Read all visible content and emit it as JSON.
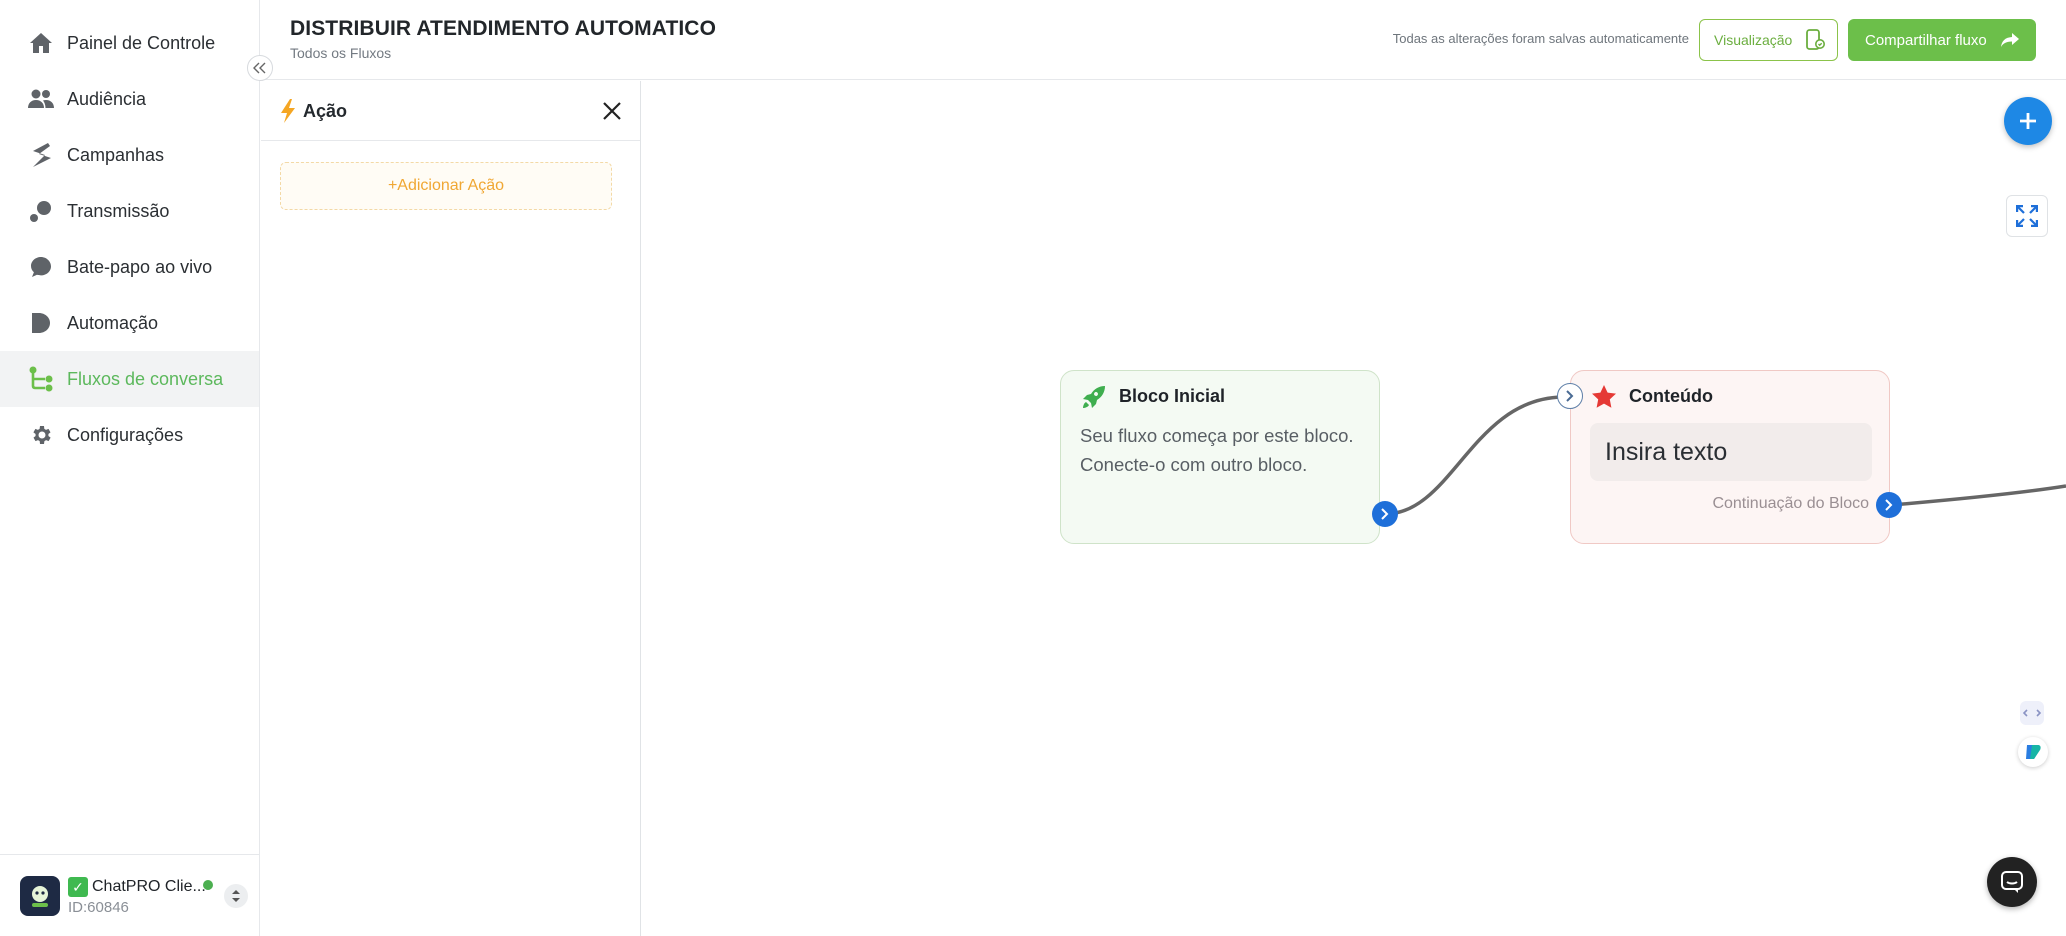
{
  "sidebar": {
    "items": [
      {
        "label": "Painel de Controle",
        "icon": "home-icon"
      },
      {
        "label": "Audiência",
        "icon": "users-icon"
      },
      {
        "label": "Campanhas",
        "icon": "campaign-icon"
      },
      {
        "label": "Transmissão",
        "icon": "broadcast-icon"
      },
      {
        "label": "Bate-papo ao vivo",
        "icon": "chat-icon"
      },
      {
        "label": "Automação",
        "icon": "automation-icon"
      },
      {
        "label": "Fluxos de conversa",
        "icon": "flow-icon"
      },
      {
        "label": "Configurações",
        "icon": "gear-icon"
      }
    ],
    "active_index": 6,
    "account": {
      "name": "ChatPRO Clie...",
      "id": "ID:60846",
      "status_color": "#4caf50"
    }
  },
  "header": {
    "title": "DISTRIBUIR ATENDIMENTO AUTOMATICO",
    "breadcrumb": "Todos os Fluxos",
    "saved_status": "Todas as alterações foram salvas automaticamente",
    "preview_label": "Visualização",
    "share_label": "Compartilhar fluxo"
  },
  "panel": {
    "title": "Ação",
    "add_action_label": "+Adicionar Ação"
  },
  "canvas": {
    "start_block": {
      "title": "Bloco Inicial",
      "description": "Seu fluxo começa por este bloco. Conecte-o com outro bloco."
    },
    "content_block": {
      "title": "Conteúdo",
      "input_text": "Insira texto",
      "continuation_label": "Continuação do Bloco"
    }
  },
  "colors": {
    "accent_green": "#6cbf4a",
    "active_nav": "#5cb85c",
    "port_blue": "#1e6fd9",
    "fab_blue": "#1e88e5",
    "add_action_orange": "#f0a733"
  }
}
